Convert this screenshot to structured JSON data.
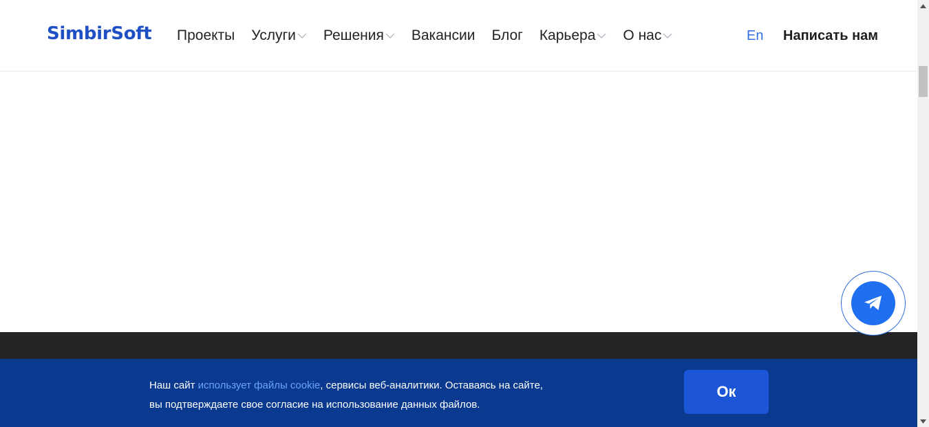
{
  "brand": {
    "logo_text": "SimbirSoft",
    "accent_color": "#1f4fc4"
  },
  "nav": {
    "items": [
      {
        "label": "Проекты",
        "has_dropdown": false
      },
      {
        "label": "Услуги",
        "has_dropdown": true
      },
      {
        "label": "Решения",
        "has_dropdown": true
      },
      {
        "label": "Вакансии",
        "has_dropdown": false
      },
      {
        "label": "Блог",
        "has_dropdown": false
      },
      {
        "label": "Карьера",
        "has_dropdown": true
      },
      {
        "label": "О нас",
        "has_dropdown": true
      }
    ],
    "language": "En",
    "contact_label": "Написать нам"
  },
  "floating": {
    "icon": "telegram-icon",
    "color": "#1f6ff0"
  },
  "cookie": {
    "text_before": "Наш сайт ",
    "link_text": "использует файлы cookie",
    "text_after_line1": ", сервисы веб-аналитики. Оставаясь на сайте,",
    "text_line2": "вы подтверждаете свое согласие на использование данных файлов.",
    "ok_label": "Ок",
    "background_color": "#0a3a8f"
  }
}
